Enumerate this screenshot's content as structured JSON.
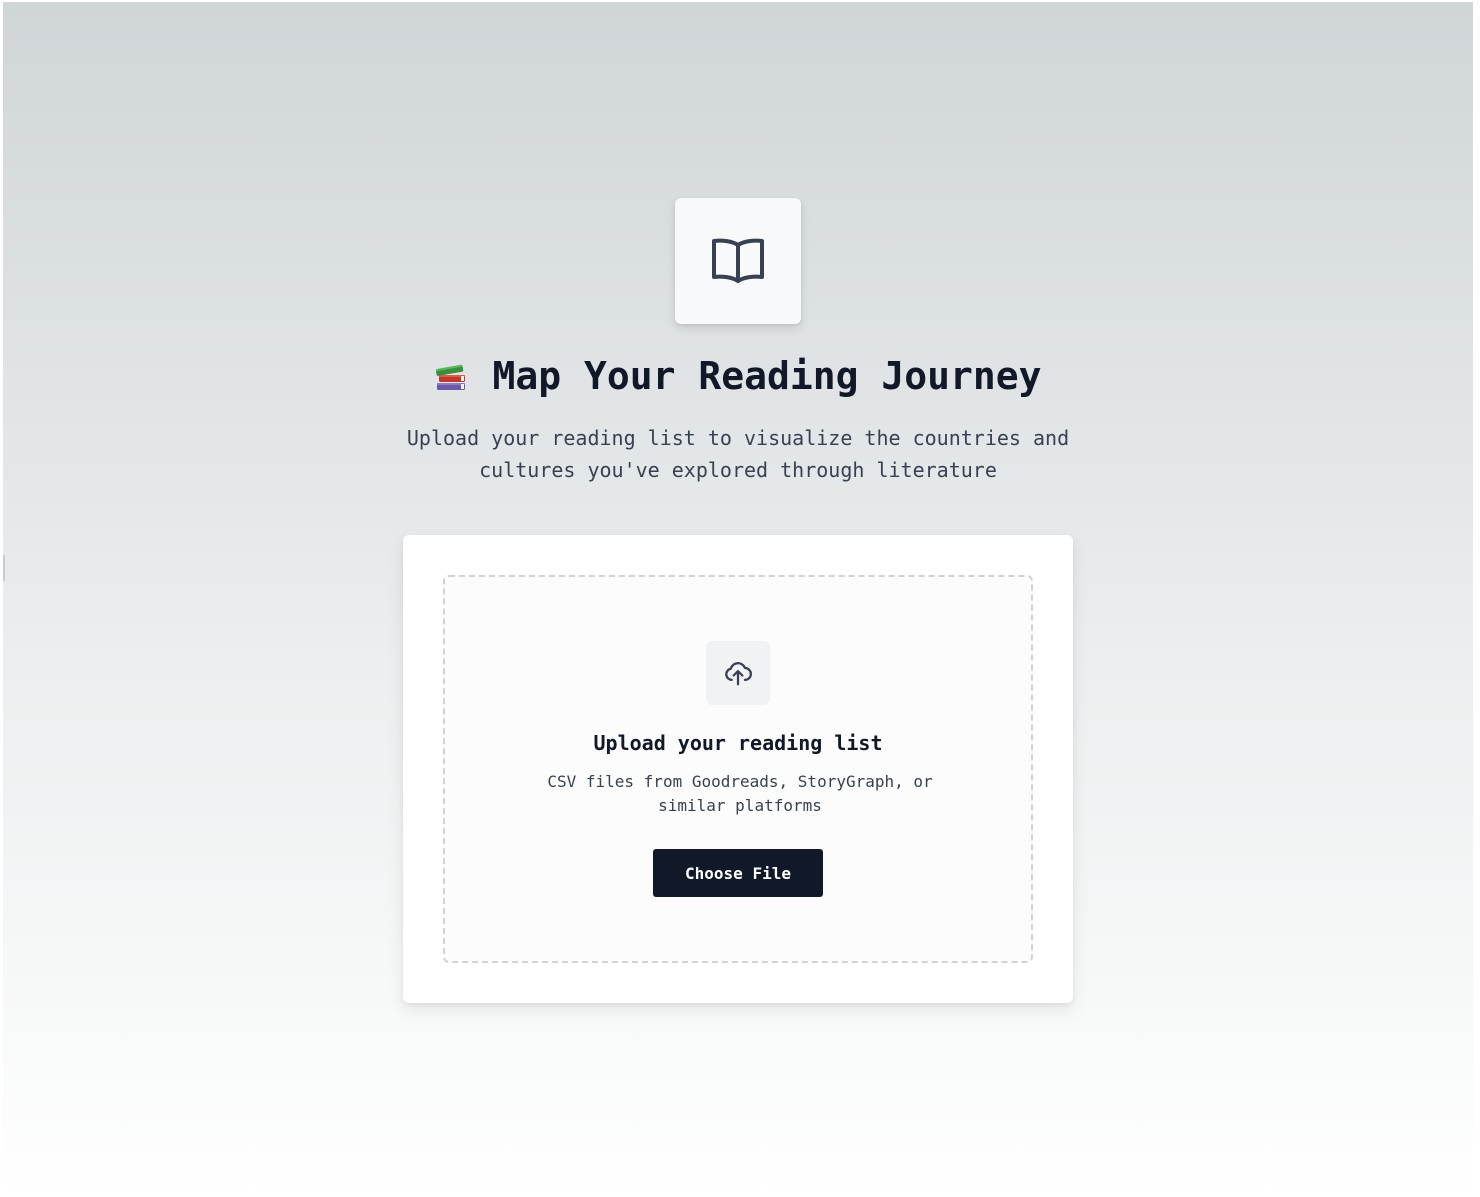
{
  "hero": {
    "logo_icon": "open-book-icon",
    "title_emoji_icon": "books-stack-icon",
    "title": "Map Your Reading Journey",
    "subtitle": "Upload your reading list to visualize the countries and cultures you've explored through literature"
  },
  "upload": {
    "icon": "cloud-upload-icon",
    "heading": "Upload your reading list",
    "description": "CSV files from Goodreads, StoryGraph, or similar platforms",
    "button_label": "Choose File"
  },
  "colors": {
    "primary_button": "#111827",
    "heading_text": "#111827",
    "body_text": "#374151",
    "dashed_border": "#cfd2d6"
  }
}
